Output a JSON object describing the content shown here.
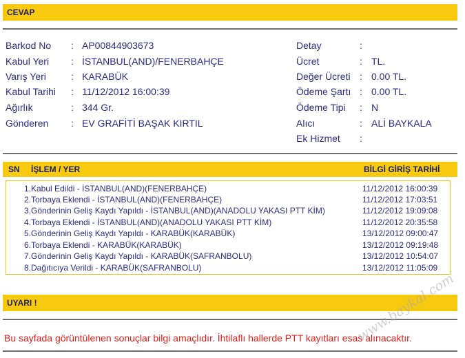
{
  "sections": {
    "answer_title": "CEVAP",
    "warning_title": "UYARI !"
  },
  "shipment": {
    "left": [
      {
        "label": "Barkod No",
        "value": "AP00844903673"
      },
      {
        "label": "Kabul Yeri",
        "value": "İSTANBUL(AND)/FENERBAHÇE"
      },
      {
        "label": "Varış Yeri",
        "value": "KARABÜK"
      },
      {
        "label": "Kabul Tarihi",
        "value": "11/12/2012 16:00:39"
      },
      {
        "label": "Ağırlık",
        "value": "344 Gr."
      },
      {
        "label": "Gönderen",
        "value": "EV GRAFİTİ BAŞAK KIRTIL"
      }
    ],
    "right": [
      {
        "label": "Detay",
        "value": ""
      },
      {
        "label": "Ücret",
        "value": "TL."
      },
      {
        "label": "Değer Ücreti",
        "value": "0.00 TL."
      },
      {
        "label": "Ödeme Şartı",
        "value": "0.00 TL."
      },
      {
        "label": "Ödeme Tipi",
        "value": "N"
      },
      {
        "label": "Alıcı",
        "value": "ALİ BAYKALA"
      },
      {
        "label": "Ek Hizmet",
        "value": ""
      }
    ]
  },
  "history": {
    "headers": {
      "sn": "SN",
      "action": "İŞLEM / YER",
      "date": "BİLGİ GİRİŞ TARİHİ"
    },
    "rows": [
      {
        "desc": "1.Kabul Edildi - İSTANBUL(AND)(FENERBAHÇE)",
        "date": "11/12/2012 16:00:39"
      },
      {
        "desc": "2.Torbaya Eklendi - İSTANBUL(AND)(FENERBAHÇE)",
        "date": "11/12/2012 17:03:51"
      },
      {
        "desc": "3.Gönderinin Geliş Kaydı Yapıldı - İSTANBUL(AND)(ANADOLU YAKASI PTT KİM)",
        "date": "11/12/2012 19:09:08"
      },
      {
        "desc": "4.Torbaya Eklendi - İSTANBUL(AND)(ANADOLU YAKASI PTT KİM)",
        "date": "11/12/2012 20:35:58"
      },
      {
        "desc": "5.Gönderinin Geliş Kaydı Yapıldı - KARABÜK(KARABÜK)",
        "date": "13/12/2012 09:00:47"
      },
      {
        "desc": "6.Torbaya Eklendi - KARABÜK(KARABÜK)",
        "date": "13/12/2012 09:19:48"
      },
      {
        "desc": "7.Gönderinin Geliş Kaydı Yapıldı - KARABÜK(SAFRANBOLU)",
        "date": "13/12/2012 10:54:07"
      },
      {
        "desc": "8.Dağıtıcıya Verildi - KARABÜK(SAFRANBOLU)",
        "date": "13/12/2012 11:05:09"
      }
    ]
  },
  "warning": {
    "text": "Bu sayfada görüntülenen sonuçlar bilgi amaçlıdır. İhtilaflı hallerde PTT kayıtları esas alınacaktır."
  },
  "watermark": "www.baykal.com",
  "colors": {
    "accent": "#f7ca10",
    "text": "#2b2b86",
    "warning": "#e0201a"
  }
}
